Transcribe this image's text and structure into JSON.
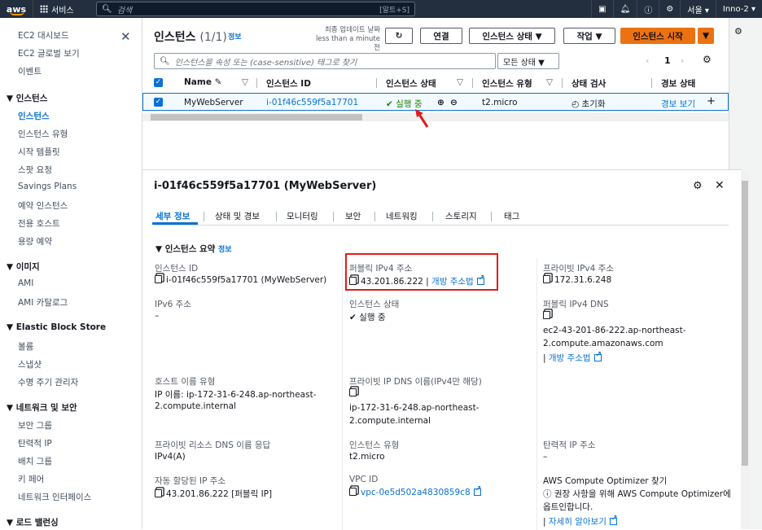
{
  "topbar": {
    "logo": "aws",
    "services": "서비스",
    "search_placeholder": "검색",
    "search_shortcut": "[알트+S]",
    "region": "서울 ▾",
    "user": "Inno-2 ▾"
  },
  "sidebar": {
    "items": [
      {
        "label": "EC2 대시보드",
        "type": "item"
      },
      {
        "label": "EC2 글로벌 보기",
        "type": "item"
      },
      {
        "label": "이벤트",
        "type": "item"
      },
      {
        "label": "▼ 인스턴스",
        "type": "head"
      },
      {
        "label": "인스턴스",
        "type": "active"
      },
      {
        "label": "인스턴스 유형",
        "type": "item"
      },
      {
        "label": "시작 템플릿",
        "type": "item"
      },
      {
        "label": "스팟 요청",
        "type": "item"
      },
      {
        "label": "Savings Plans",
        "type": "item"
      },
      {
        "label": "예약 인스턴스",
        "type": "item"
      },
      {
        "label": "전용 호스트",
        "type": "item"
      },
      {
        "label": "용량 예약",
        "type": "item"
      },
      {
        "label": "▼ 이미지",
        "type": "head"
      },
      {
        "label": "AMI",
        "type": "item"
      },
      {
        "label": "AMI 카탈로그",
        "type": "item"
      },
      {
        "label": "▼ Elastic Block Store",
        "type": "head"
      },
      {
        "label": "볼륨",
        "type": "item"
      },
      {
        "label": "스냅샷",
        "type": "item"
      },
      {
        "label": "수명 주기 관리자",
        "type": "item"
      },
      {
        "label": "▼ 네트워크 및 보안",
        "type": "head"
      },
      {
        "label": "보안 그룹",
        "type": "item"
      },
      {
        "label": "탄력적 IP",
        "type": "item"
      },
      {
        "label": "배치 그룹",
        "type": "item"
      },
      {
        "label": "키 페어",
        "type": "item"
      },
      {
        "label": "네트워크 인터페이스",
        "type": "item"
      },
      {
        "label": "▼ 로드 밸런싱",
        "type": "head"
      }
    ]
  },
  "instances": {
    "title": "인스턴스",
    "count": "(1/1)",
    "info": "정보",
    "last_update_1": "최종 업데이트 날짜",
    "last_update_2": "less than a minute 전",
    "connect": "연결",
    "state_btn": "인스턴스 상태 ▼",
    "actions": "작업 ▼",
    "launch": "인스턴스 시작",
    "filter_placeholder": "인스턴스을 속성 또는 (case-sensitive) 태그로 찾기",
    "state_filter": "모든 상태 ▼",
    "page": "1",
    "columns": [
      "Name",
      "인스턴스 ID",
      "인스턴스 상태",
      "인스턴스 유형",
      "상태 검사",
      "경보 상태"
    ],
    "row": {
      "name": "MyWebServer",
      "id": "i-01f46c559f5a17701",
      "state": "실행 중",
      "type": "t2.micro",
      "check": "초기화",
      "alarm": "경보 보기"
    }
  },
  "detail": {
    "title": "i-01f46c559f5a17701 (MyWebServer)",
    "tabs": [
      "세부 정보",
      "상태 및 경보",
      "모니터링",
      "보안",
      "네트워킹",
      "스토리지",
      "태그"
    ],
    "summary": "▼ 인스턴스 요약",
    "summary_info": "정보",
    "fields": {
      "instance_id_label": "인스턴스 ID",
      "instance_id": "i-01f46c559f5a17701 (MyWebServer)",
      "public_ipv4_label": "퍼블릭 IPv4 주소",
      "public_ipv4": "43.201.86.222",
      "open_address": "개방 주소법",
      "private_ipv4_label": "프라이빗 IPv4 주소",
      "private_ipv4": "172.31.6.248",
      "ipv6_label": "IPv6 주소",
      "ipv6": "–",
      "state_label": "인스턴스 상태",
      "state": "실행 중",
      "public_dns_label": "퍼블릭 IPv4 DNS",
      "public_dns_1": "ec2-43-201-86-222.ap-northeast-",
      "public_dns_2": "2.compute.amazonaws.com",
      "public_dns_link": "개방 주소법",
      "hostname_type_label": "호스트 이름 유형",
      "hostname_1": "IP 이름: ip-172-31-6-248.ap-northeast-",
      "hostname_2": "2.compute.internal",
      "private_dns_label": "프라이빗 IP DNS 이름(IPv4만 해당)",
      "private_dns_1": "ip-172-31-6-248.ap-northeast-",
      "private_dns_2": "2.compute.internal",
      "answer_dns_label": "프라이빗 리소스 DNS 이름 응답",
      "answer_dns": "IPv4(A)",
      "type_label": "인스턴스 유형",
      "type": "t2.micro",
      "eip_label": "탄력적 IP 주소",
      "eip": "–",
      "auto_ip_label": "자동 할당된 IP 주소",
      "auto_ip": "43.201.86.222 [퍼블릭 IP]",
      "vpc_label": "VPC ID",
      "vpc": "vpc-0e5d502a4830859c8",
      "optimizer_label": "AWS Compute Optimizer 찾기",
      "optimizer_1": "권장 사항을 위해 AWS Compute Optimizer에",
      "optimizer_2": "옵트인합니다.",
      "learn_more": "자세히 알아보기"
    }
  }
}
